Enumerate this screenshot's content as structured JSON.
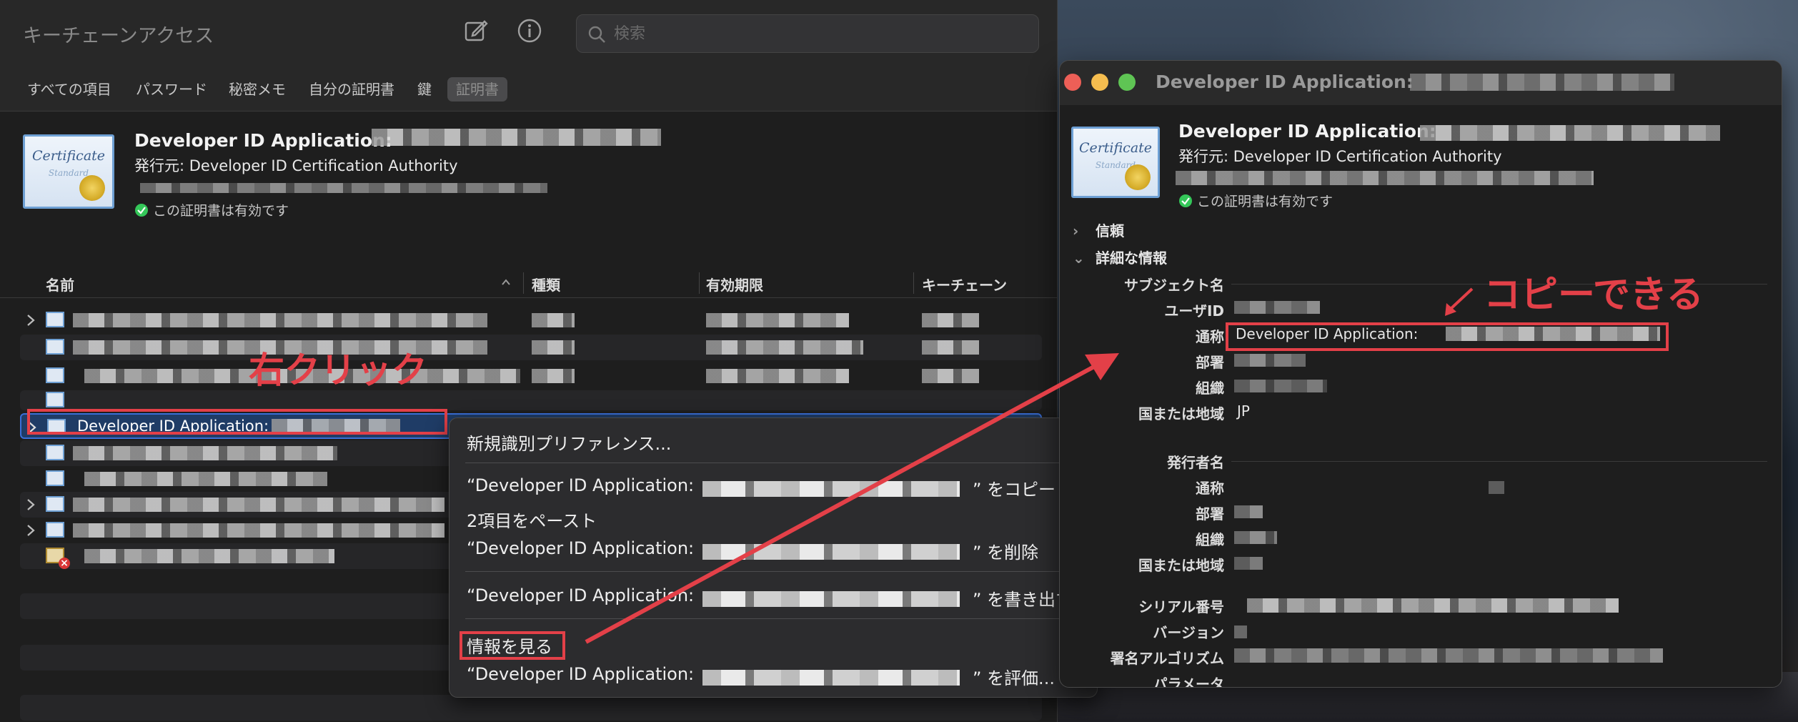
{
  "keychain": {
    "title": "キーチェーンアクセス",
    "search_placeholder": "検索",
    "tabs": [
      "すべての項目",
      "パスワード",
      "秘密メモ",
      "自分の証明書",
      "鍵",
      "証明書"
    ],
    "active_tab_index": 5,
    "header": {
      "cert_word": "Certificate",
      "cert_sub": "Standard",
      "title": "Developer ID Application:",
      "issuer": "発行元: Developer ID Certification Authority",
      "validity": "この証明書は有効です"
    },
    "columns": [
      "名前",
      "種類",
      "有効期限",
      "キーチェーン"
    ],
    "selected_row_label": "Developer ID Application:"
  },
  "annotations": {
    "right_click": "右クリック",
    "can_copy": "コピーできる"
  },
  "context_menu": {
    "items": [
      "新規識別プリファレンス...",
      "“Developer ID Application: ",
      "2項目をペースト",
      "“Developer ID Application: ",
      "“Developer ID Application: ",
      "情報を見る",
      "“Developer ID Application: "
    ],
    "suffixes": [
      "",
      "” をコピー",
      "",
      "” を削除",
      "” を書き出す...",
      "",
      "” を評価..."
    ]
  },
  "info_window": {
    "title": "Developer ID Application:",
    "header_title": "Developer ID Application:",
    "issuer": "発行元: Developer ID Certification Authority",
    "validity": "この証明書は有効です",
    "sections": [
      "信頼",
      "詳細な情報"
    ],
    "subject_heading": "サブジェクト名",
    "subject": [
      {
        "key": "ユーザID",
        "value": ""
      },
      {
        "key": "通称",
        "value": "Developer ID Application:"
      },
      {
        "key": "部署",
        "value": ""
      },
      {
        "key": "組織",
        "value": ""
      },
      {
        "key": "国または地域",
        "value": "JP"
      }
    ],
    "issuer_heading": "発行者名",
    "issuer_fields": [
      "通称",
      "部署",
      "組織",
      "国または地域"
    ],
    "other_fields": [
      "シリアル番号",
      "バージョン",
      "署名アルゴリズム",
      "パラメータ"
    ]
  },
  "colors": {
    "annotation_red": "#e34048",
    "selection_blue": "#3a6fd8",
    "traffic_red": "#ed5f57",
    "traffic_yellow": "#f5bd4f",
    "traffic_green": "#5fc454"
  }
}
